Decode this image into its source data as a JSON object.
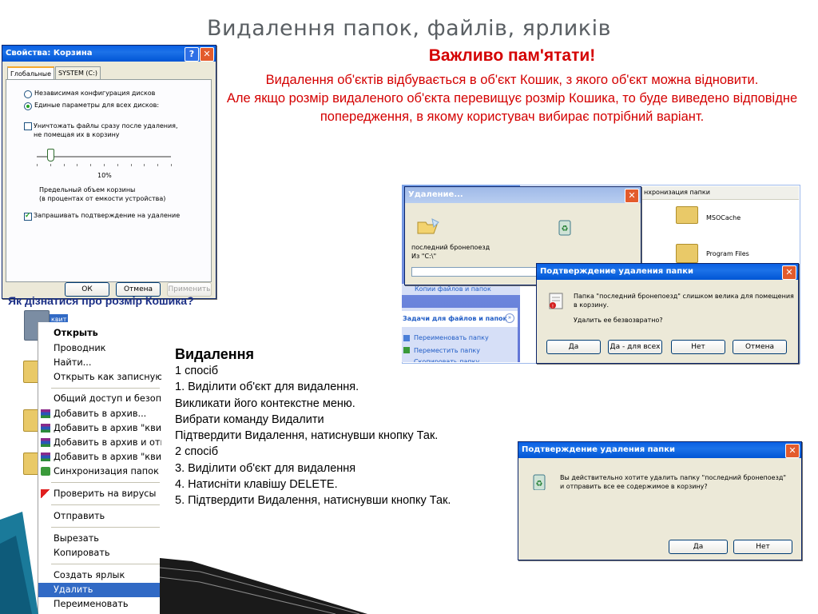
{
  "slide": {
    "title": "Видалення папок, файлів, ярликів",
    "important_heading": "Важливо пам'ятати!",
    "important_text_1": "Видалення об'єктів відбувається в об'єкт Кошик, з якого об'єкт можна відновити.",
    "important_text_2": "Але якщо розмір видаленого об'єкта перевищує розмір Кошика, то буде виведено відповідне попередження, в якому користувач вибирає потрібний варіант.",
    "bin_size_question": "Як дізнатися про розмір Кошика?",
    "delete_heading": "Видалення",
    "steps": [
      "1 спосіб",
      "1. Виділити об'єкт для видалення.",
      "Викликати його контекстне меню.",
      "Вибрати команду Видалити",
      "Підтвердити Видалення, натиснувши кнопку Так.",
      "2 спосіб",
      "3. Виділити об'єкт для видалення",
      "4. Натисніти клавішу DELETE.",
      "5. Підтвердити Видалення, натиснувши кнопку Так."
    ]
  },
  "properties_window": {
    "title": "Свойства: Корзина",
    "help_glyph": "?",
    "close_glyph": "✕",
    "tabs": [
      "Глобальные",
      "SYSTEM (C:)"
    ],
    "radio_independent": "Независимая конфигурация дисков",
    "radio_single": "Единые параметры для всех дисков:",
    "destroy_checkbox_line1": "Уничтожать файлы сразу после удаления,",
    "destroy_checkbox_line2": "не помещая их в корзину",
    "slider_value": "10%",
    "slider_level": 0.1,
    "max_size_line1": "Предельный объем корзины",
    "max_size_line2": "(в процентах от емкости устройства)",
    "confirm_checkbox": "Запрашивать подтверждение на удаление",
    "buttons": {
      "ok": "ОК",
      "cancel": "Отмена",
      "apply": "Применить"
    }
  },
  "context_menu": {
    "selected_label": "квит",
    "items": [
      {
        "label": "Открыть",
        "bold": true
      },
      {
        "label": "Проводник"
      },
      {
        "label": "Найти..."
      },
      {
        "label": "Открыть как записную к"
      },
      {
        "label": "Общий доступ и безопас"
      },
      {
        "label": "Добавить в архив..."
      },
      {
        "label": "Добавить в архив \"квит."
      },
      {
        "label": "Добавить в архив и отпр"
      },
      {
        "label": "Добавить в архив \"квит."
      },
      {
        "label": "Синхронизация папок Gr"
      },
      {
        "label": "Проверить на вирусы"
      },
      {
        "label": "Отправить"
      },
      {
        "label": "Вырезать"
      },
      {
        "label": "Копировать"
      },
      {
        "label": "Создать ярлык"
      },
      {
        "label": "Удалить",
        "selected": true
      },
      {
        "label": "Переименовать"
      }
    ]
  },
  "explorer": {
    "sync_text": "нхронизация папки",
    "folder_msocache": "MSOCache",
    "folder_program_files": "Program Files",
    "tasks_header": "Задачи для файлов и папок",
    "tasks": [
      "Переименовать папку",
      "Переместить папку",
      "Скопировать папку"
    ],
    "partial_task": "Копии файлов и папок"
  },
  "deleting_dialog": {
    "title": "Удаление...",
    "close_glyph": "✕",
    "item_name": "последний бронепоезд",
    "from_path": "Из \"C:\\\""
  },
  "confirm_big": {
    "title": "Подтверждение удаления папки",
    "close_glyph": "✕",
    "message_line1": "Папка \"последний бронепоезд\" слишком велика для помещения",
    "message_line2": "в корзину.",
    "question": "Удалить ее безвозвратно?",
    "buttons": {
      "yes": "Да",
      "yes_all": "Да - для всех",
      "no": "Нет",
      "cancel": "Отмена"
    }
  },
  "confirm_small": {
    "title": "Подтверждение удаления папки",
    "close_glyph": "✕",
    "message_line1": "Вы действительно хотите удалить папку \"последний бронепоезд\"",
    "message_line2": "и отправить все ее содержимое в корзину?",
    "buttons": {
      "yes": "Да",
      "no": "Нет"
    }
  },
  "colors": {
    "accent_red": "#d40000",
    "question_blue": "#1b2f86",
    "xp_title_blue": "#0a5fe3",
    "selection_blue": "#316ac5"
  }
}
